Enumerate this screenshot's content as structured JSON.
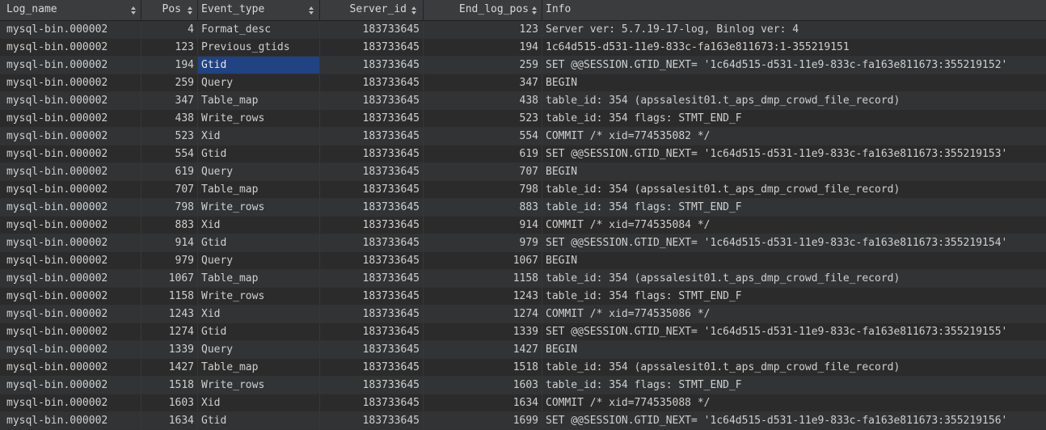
{
  "columns": [
    {
      "label": "Log_name",
      "sortable": true
    },
    {
      "label": "Pos",
      "sortable": true
    },
    {
      "label": "Event_type",
      "sortable": true
    },
    {
      "label": "Server_id",
      "sortable": true
    },
    {
      "label": "End_log_pos",
      "sortable": true
    },
    {
      "label": "Info",
      "sortable": false
    }
  ],
  "selected": {
    "row": 2,
    "column": "Event_type"
  },
  "rows": [
    {
      "log_name": "mysql-bin.000002",
      "pos": "4",
      "event_type": "Format_desc",
      "server_id": "183733645",
      "end_log_pos": "123",
      "info": "Server ver: 5.7.19-17-log, Binlog ver: 4"
    },
    {
      "log_name": "mysql-bin.000002",
      "pos": "123",
      "event_type": "Previous_gtids",
      "server_id": "183733645",
      "end_log_pos": "194",
      "info": "1c64d515-d531-11e9-833c-fa163e811673:1-355219151"
    },
    {
      "log_name": "mysql-bin.000002",
      "pos": "194",
      "event_type": "Gtid",
      "server_id": "183733645",
      "end_log_pos": "259",
      "info": "SET @@SESSION.GTID_NEXT= '1c64d515-d531-11e9-833c-fa163e811673:355219152'"
    },
    {
      "log_name": "mysql-bin.000002",
      "pos": "259",
      "event_type": "Query",
      "server_id": "183733645",
      "end_log_pos": "347",
      "info": "BEGIN"
    },
    {
      "log_name": "mysql-bin.000002",
      "pos": "347",
      "event_type": "Table_map",
      "server_id": "183733645",
      "end_log_pos": "438",
      "info": "table_id: 354 (apssalesit01.t_aps_dmp_crowd_file_record)"
    },
    {
      "log_name": "mysql-bin.000002",
      "pos": "438",
      "event_type": "Write_rows",
      "server_id": "183733645",
      "end_log_pos": "523",
      "info": "table_id: 354 flags: STMT_END_F"
    },
    {
      "log_name": "mysql-bin.000002",
      "pos": "523",
      "event_type": "Xid",
      "server_id": "183733645",
      "end_log_pos": "554",
      "info": "COMMIT /* xid=774535082 */"
    },
    {
      "log_name": "mysql-bin.000002",
      "pos": "554",
      "event_type": "Gtid",
      "server_id": "183733645",
      "end_log_pos": "619",
      "info": "SET @@SESSION.GTID_NEXT= '1c64d515-d531-11e9-833c-fa163e811673:355219153'"
    },
    {
      "log_name": "mysql-bin.000002",
      "pos": "619",
      "event_type": "Query",
      "server_id": "183733645",
      "end_log_pos": "707",
      "info": "BEGIN"
    },
    {
      "log_name": "mysql-bin.000002",
      "pos": "707",
      "event_type": "Table_map",
      "server_id": "183733645",
      "end_log_pos": "798",
      "info": "table_id: 354 (apssalesit01.t_aps_dmp_crowd_file_record)"
    },
    {
      "log_name": "mysql-bin.000002",
      "pos": "798",
      "event_type": "Write_rows",
      "server_id": "183733645",
      "end_log_pos": "883",
      "info": "table_id: 354 flags: STMT_END_F"
    },
    {
      "log_name": "mysql-bin.000002",
      "pos": "883",
      "event_type": "Xid",
      "server_id": "183733645",
      "end_log_pos": "914",
      "info": "COMMIT /* xid=774535084 */"
    },
    {
      "log_name": "mysql-bin.000002",
      "pos": "914",
      "event_type": "Gtid",
      "server_id": "183733645",
      "end_log_pos": "979",
      "info": "SET @@SESSION.GTID_NEXT= '1c64d515-d531-11e9-833c-fa163e811673:355219154'"
    },
    {
      "log_name": "mysql-bin.000002",
      "pos": "979",
      "event_type": "Query",
      "server_id": "183733645",
      "end_log_pos": "1067",
      "info": "BEGIN"
    },
    {
      "log_name": "mysql-bin.000002",
      "pos": "1067",
      "event_type": "Table_map",
      "server_id": "183733645",
      "end_log_pos": "1158",
      "info": "table_id: 354 (apssalesit01.t_aps_dmp_crowd_file_record)"
    },
    {
      "log_name": "mysql-bin.000002",
      "pos": "1158",
      "event_type": "Write_rows",
      "server_id": "183733645",
      "end_log_pos": "1243",
      "info": "table_id: 354 flags: STMT_END_F"
    },
    {
      "log_name": "mysql-bin.000002",
      "pos": "1243",
      "event_type": "Xid",
      "server_id": "183733645",
      "end_log_pos": "1274",
      "info": "COMMIT /* xid=774535086 */"
    },
    {
      "log_name": "mysql-bin.000002",
      "pos": "1274",
      "event_type": "Gtid",
      "server_id": "183733645",
      "end_log_pos": "1339",
      "info": "SET @@SESSION.GTID_NEXT= '1c64d515-d531-11e9-833c-fa163e811673:355219155'"
    },
    {
      "log_name": "mysql-bin.000002",
      "pos": "1339",
      "event_type": "Query",
      "server_id": "183733645",
      "end_log_pos": "1427",
      "info": "BEGIN"
    },
    {
      "log_name": "mysql-bin.000002",
      "pos": "1427",
      "event_type": "Table_map",
      "server_id": "183733645",
      "end_log_pos": "1518",
      "info": "table_id: 354 (apssalesit01.t_aps_dmp_crowd_file_record)"
    },
    {
      "log_name": "mysql-bin.000002",
      "pos": "1518",
      "event_type": "Write_rows",
      "server_id": "183733645",
      "end_log_pos": "1603",
      "info": "table_id: 354 flags: STMT_END_F"
    },
    {
      "log_name": "mysql-bin.000002",
      "pos": "1603",
      "event_type": "Xid",
      "server_id": "183733645",
      "end_log_pos": "1634",
      "info": "COMMIT /* xid=774535088 */"
    },
    {
      "log_name": "mysql-bin.000002",
      "pos": "1634",
      "event_type": "Gtid",
      "server_id": "183733645",
      "end_log_pos": "1699",
      "info": "SET @@SESSION.GTID_NEXT= '1c64d515-d531-11e9-833c-fa163e811673:355219156'"
    }
  ]
}
